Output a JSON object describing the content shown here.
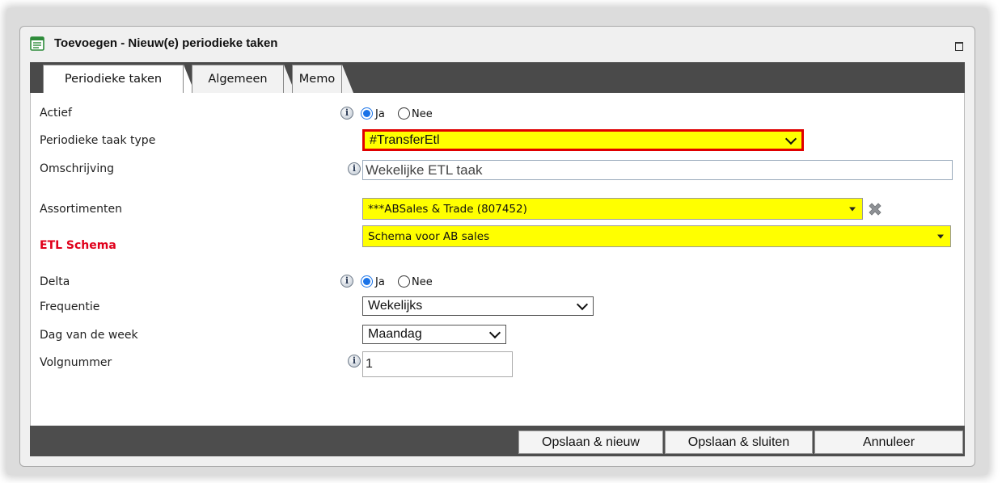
{
  "window": {
    "title": "Toevoegen - Nieuw(e) periodieke taken"
  },
  "tabs": [
    {
      "label": "Periodieke taken",
      "active": true
    },
    {
      "label": "Algemeen",
      "active": false
    },
    {
      "label": "Memo",
      "active": false
    }
  ],
  "form": {
    "actief": {
      "label": "Actief",
      "options": [
        "Ja",
        "Nee"
      ],
      "selected": "Ja"
    },
    "taak_type": {
      "label": "Periodieke taak type",
      "value": "#TransferEtl"
    },
    "omschrijving": {
      "label": "Omschrijving",
      "value": "Wekelijke ETL taak"
    },
    "assortimenten": {
      "label": "Assortimenten",
      "value": "***ABSales & Trade (807452)"
    },
    "etl_schema": {
      "label": "ETL Schema",
      "value": "Schema voor AB sales"
    },
    "delta": {
      "label": "Delta",
      "options": [
        "Ja",
        "Nee"
      ],
      "selected": "Ja"
    },
    "frequentie": {
      "label": "Frequentie",
      "value": "Wekelijks"
    },
    "dag": {
      "label": "Dag van de week",
      "value": "Maandag"
    },
    "volgnummer": {
      "label": "Volgnummer",
      "value": "1"
    }
  },
  "footer": {
    "save_new": "Opslaan & nieuw",
    "save_close": "Opslaan & sluiten",
    "cancel": "Annuleer"
  },
  "icons": {
    "title": "form-icon",
    "info": "info-icon",
    "remove": "remove-x-icon"
  },
  "colors": {
    "highlight_yellow": "#ffff00",
    "error_border_red": "#e00000",
    "required_label_red": "#e0001b",
    "radio_blue": "#1a73e8",
    "bar_dark": "#4a4a4a"
  }
}
